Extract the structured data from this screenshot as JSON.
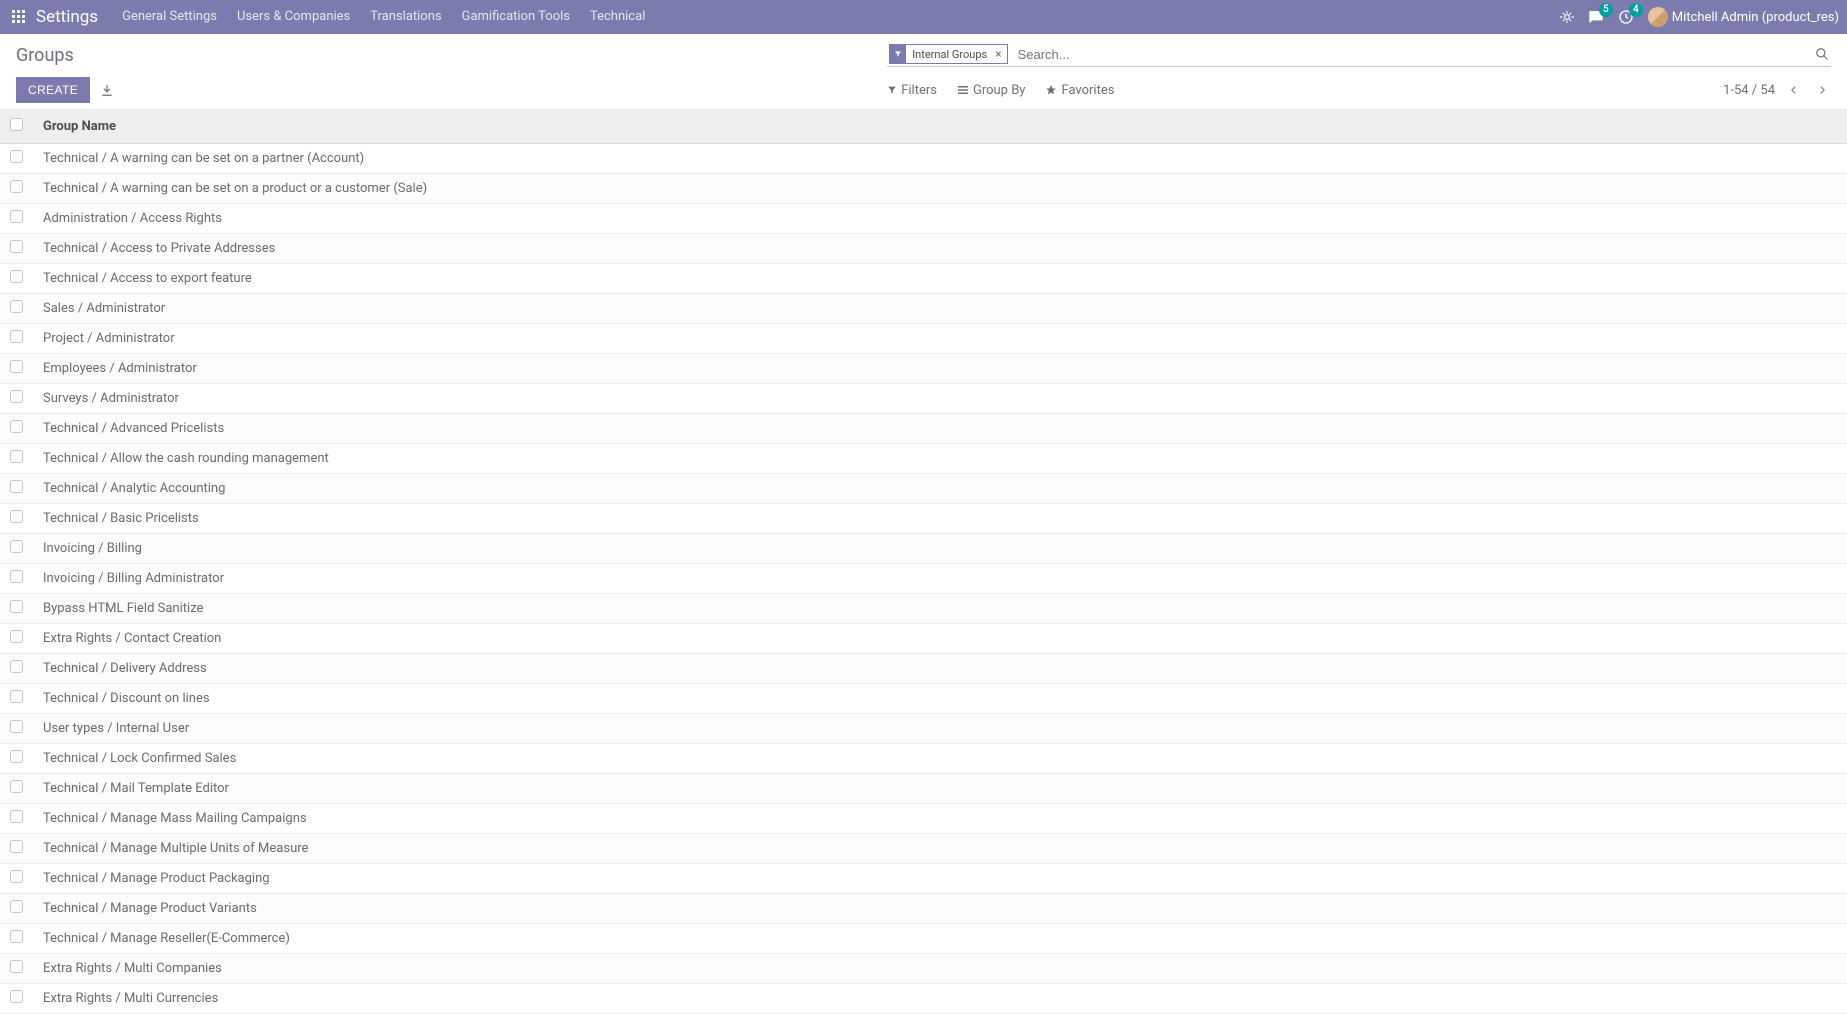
{
  "navbar": {
    "brand": "Settings",
    "links": [
      "General Settings",
      "Users & Companies",
      "Translations",
      "Gamification Tools",
      "Technical"
    ],
    "messages_badge": "5",
    "activities_badge": "4",
    "username": "Mitchell Admin (product_res)"
  },
  "control_panel": {
    "title": "Groups",
    "search_facet": "Internal Groups",
    "search_placeholder": "Search...",
    "create_label": "CREATE",
    "filters_label": "Filters",
    "groupby_label": "Group By",
    "favorites_label": "Favorites",
    "pager_text": "1-54 / 54"
  },
  "table": {
    "header": "Group Name",
    "rows": [
      "Technical / A warning can be set on a partner (Account)",
      "Technical / A warning can be set on a product or a customer (Sale)",
      "Administration / Access Rights",
      "Technical / Access to Private Addresses",
      "Technical / Access to export feature",
      "Sales / Administrator",
      "Project / Administrator",
      "Employees / Administrator",
      "Surveys / Administrator",
      "Technical / Advanced Pricelists",
      "Technical / Allow the cash rounding management",
      "Technical / Analytic Accounting",
      "Technical / Basic Pricelists",
      "Invoicing / Billing",
      "Invoicing / Billing Administrator",
      "Bypass HTML Field Sanitize",
      "Extra Rights / Contact Creation",
      "Technical / Delivery Address",
      "Technical / Discount on lines",
      "User types / Internal User",
      "Technical / Lock Confirmed Sales",
      "Technical / Mail Template Editor",
      "Technical / Manage Mass Mailing Campaigns",
      "Technical / Manage Multiple Units of Measure",
      "Technical / Manage Product Packaging",
      "Technical / Manage Product Variants",
      "Technical / Manage Reseller(E-Commerce)",
      "Extra Rights / Multi Companies",
      "Extra Rights / Multi Currencies"
    ]
  }
}
